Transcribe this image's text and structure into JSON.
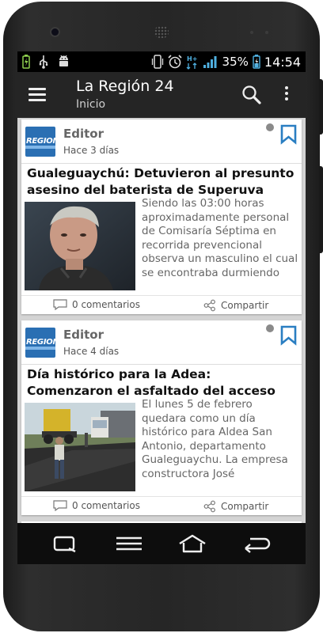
{
  "status_bar": {
    "left_icons": [
      "battery-charging-icon",
      "usb-icon",
      "android-debug-icon"
    ],
    "right_icons": [
      "vibrate-icon",
      "alarm-icon",
      "hplus-data-icon",
      "signal-icon",
      "battery-icon"
    ],
    "battery_percent": "35%",
    "time": "14:54"
  },
  "app_bar": {
    "title": "La Región 24",
    "subtitle": "Inicio",
    "icons": [
      "menu-icon",
      "search-icon",
      "more-vertical-icon"
    ]
  },
  "articles": [
    {
      "logo_text": "REGION",
      "author": "Editor",
      "date": "Hace 3 días",
      "title": "Gualeguaychú: Detuvieron al presunto asesino del baterista de Superuva",
      "excerpt": "Siendo las  03:00 horas aproximadamente personal de Comisaría Séptima en recorrida prevencional observa un masculino el cual se encontraba durmiendo",
      "comments": "0 comentarios",
      "share": "Compartir"
    },
    {
      "logo_text": "REGION",
      "author": "Editor",
      "date": "Hace 4 días",
      "title": "Día histórico para la Adea: Comenzaron el asfaltado del acceso",
      "excerpt": "El lunes 5 de febrero quedara como un día histórico para Aldea San Antonio, departamento Gualeguaychu. La empresa constructora José",
      "comments": "0 comentarios",
      "share": "Compartir"
    }
  ],
  "nav_bar": {
    "icons": [
      "recent-apps-icon",
      "menu-lines-icon",
      "home-icon",
      "back-icon"
    ]
  },
  "colors": {
    "app_bar": "#252525",
    "status_bar": "#000000",
    "accent": "#2a7ec2",
    "background": "#d4d4d4",
    "logo": "#2a6fb3"
  }
}
